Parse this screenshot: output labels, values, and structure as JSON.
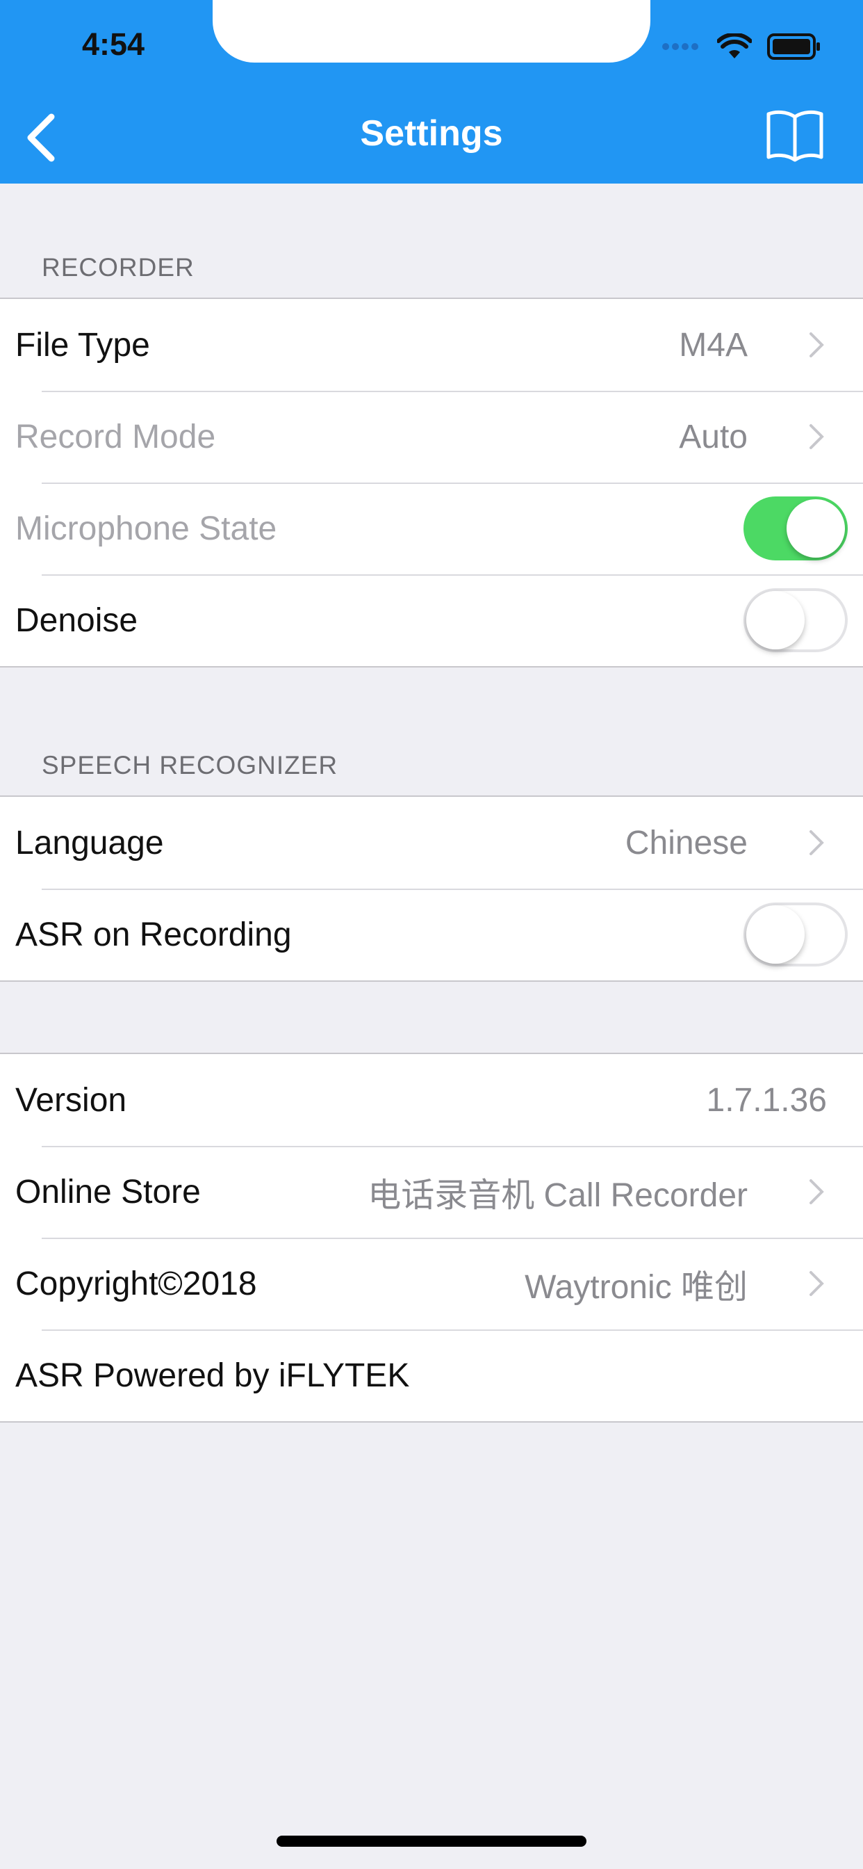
{
  "status_bar": {
    "time": "4:54"
  },
  "nav": {
    "title": "Settings",
    "back_icon": "chevron-left-icon",
    "right_icon": "book-icon"
  },
  "sections": {
    "recorder": {
      "header": "RECORDER",
      "rows": [
        {
          "label": "File Type",
          "value": "M4A"
        },
        {
          "label": "Record Mode",
          "value": "Auto"
        },
        {
          "label": "Microphone State",
          "toggle": true
        },
        {
          "label": "Denoise",
          "toggle": false
        }
      ]
    },
    "speech": {
      "header": "SPEECH RECOGNIZER",
      "rows": [
        {
          "label": "Language",
          "value": "Chinese"
        },
        {
          "label": "ASR on Recording",
          "toggle": false
        }
      ]
    },
    "about": {
      "rows": [
        {
          "label": "Version",
          "value": "1.7.1.36"
        },
        {
          "label": "Online Store",
          "value": "电话录音机 Call Recorder"
        },
        {
          "label": "Copyright©2018",
          "value": "Waytronic 唯创"
        },
        {
          "label": "ASR Powered by iFLYTEK"
        }
      ]
    }
  },
  "colors": {
    "nav_bg": "#2196F3",
    "toggle_on": "#4CD964",
    "bg": "#EFEFF4"
  }
}
